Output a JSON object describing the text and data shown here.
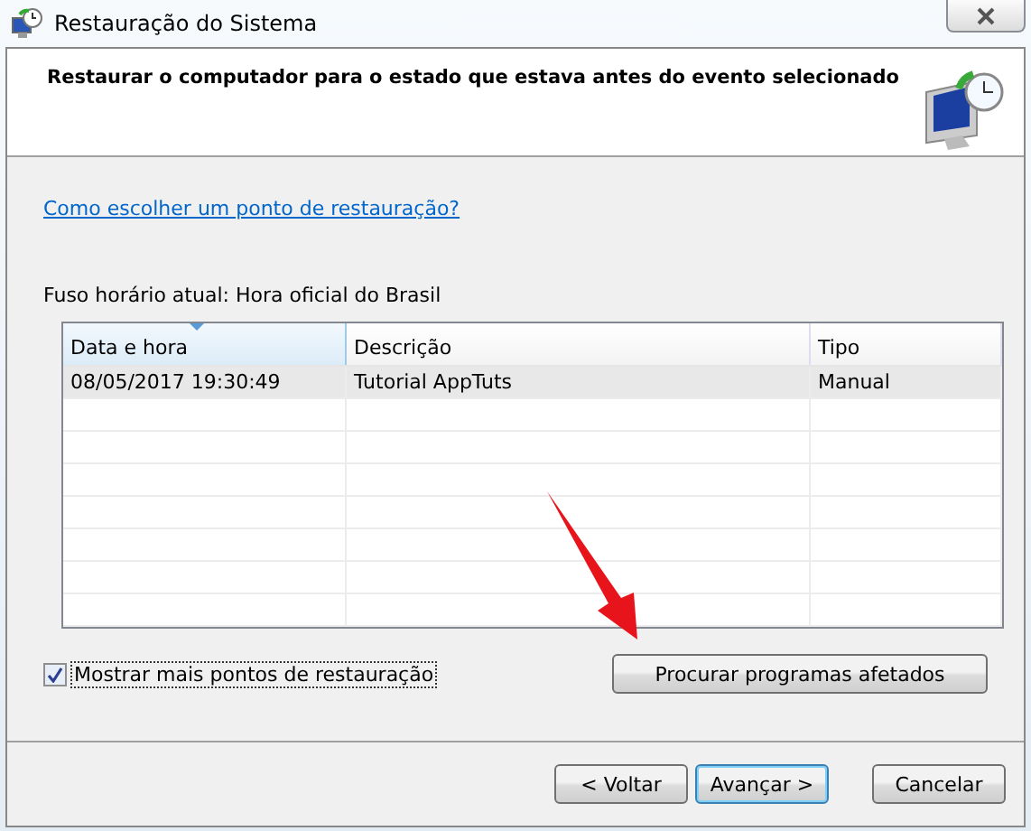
{
  "window": {
    "title": "Restauração do Sistema"
  },
  "header": {
    "heading": "Restaurar o computador para o estado que estava antes do evento selecionado"
  },
  "help_link": "Como escolher um ponto de restauração?",
  "time_zone": "Fuso horário atual: Hora oficial do Brasil",
  "table": {
    "columns": [
      {
        "label": "Data e hora",
        "sorted": true
      },
      {
        "label": "Descrição",
        "sorted": false
      },
      {
        "label": "Tipo",
        "sorted": false
      }
    ],
    "rows": [
      {
        "cells": [
          "08/05/2017 19:30:49",
          "Tutorial AppTuts",
          "Manual"
        ],
        "selected": true
      }
    ]
  },
  "show_more": {
    "label": "Mostrar mais pontos de restauração",
    "checked": true
  },
  "scan_button": "Procurar programas afetados",
  "buttons": [
    {
      "label": "< Voltar",
      "default": false
    },
    {
      "label": "Avançar >",
      "default": true
    },
    {
      "label": "Cancelar",
      "default": false
    }
  ]
}
